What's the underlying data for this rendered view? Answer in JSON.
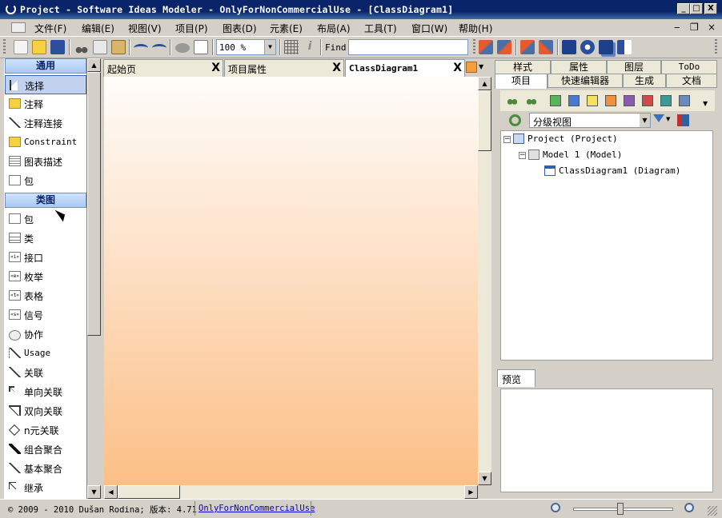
{
  "window": {
    "title": "Project - Software Ideas Modeler - OnlyForNonCommercialUse - [ClassDiagram1]",
    "minimize": "_",
    "maximize": "□",
    "close": "X"
  },
  "menu": {
    "items": [
      "文件(F)",
      "编辑(E)",
      "视图(V)",
      "项目(P)",
      "图表(D)",
      "元素(E)",
      "布局(A)",
      "工具(T)",
      "窗口(W)",
      "帮助(H)"
    ],
    "mdi_minimize": "‒",
    "mdi_restore": "❐",
    "mdi_close": "×"
  },
  "toolbar": {
    "zoom_value": "100 %",
    "find_label": "Find",
    "find_value": ""
  },
  "toolbox": {
    "section_general": "通用",
    "general_items": [
      "选择",
      "注释",
      "注释连接",
      "Constraint",
      "图表描述",
      "包"
    ],
    "section_class": "类图",
    "class_items": [
      "包",
      "类",
      "接口",
      "枚举",
      "表格",
      "信号",
      "协作",
      "Usage",
      "关联",
      "单向关联",
      "双向关联",
      "n元关联",
      "组合聚合",
      "基本聚合",
      "继承"
    ],
    "stereo_icons": {
      "interface": "«i»",
      "enum": "«e»",
      "table": "«t»",
      "signal": "«s»"
    }
  },
  "doc_tabs": [
    {
      "label": "起始页",
      "active": false
    },
    {
      "label": "项目属性",
      "active": false
    },
    {
      "label": "ClassDiagram1",
      "active": true
    }
  ],
  "close_glyph": "X",
  "right_panel": {
    "tabs_row1": [
      "样式",
      "属性",
      "图层",
      "ToDo"
    ],
    "tabs_row2": [
      "项目",
      "快速编辑器",
      "生成",
      "文档"
    ],
    "view_combo": "分级视图",
    "tree": [
      {
        "label": "Project (Project)",
        "expander": "−"
      },
      {
        "label": "Model 1 (Model)",
        "expander": "−"
      },
      {
        "label": "ClassDiagram1 (Diagram)",
        "expander": ""
      }
    ],
    "preview_tab": "预览"
  },
  "status": {
    "copyright": "© 2009 - 2010 Dušan Rodina; 版本: 4.71",
    "license_link": "OnlyForNonCommercialUse",
    "zoom_level": 0.47
  },
  "colors": {
    "title_bar": "#0a246a",
    "canvas_top": "#fffdfb",
    "canvas_bottom": "#fcbf86",
    "selection": "#c1d2ee"
  }
}
